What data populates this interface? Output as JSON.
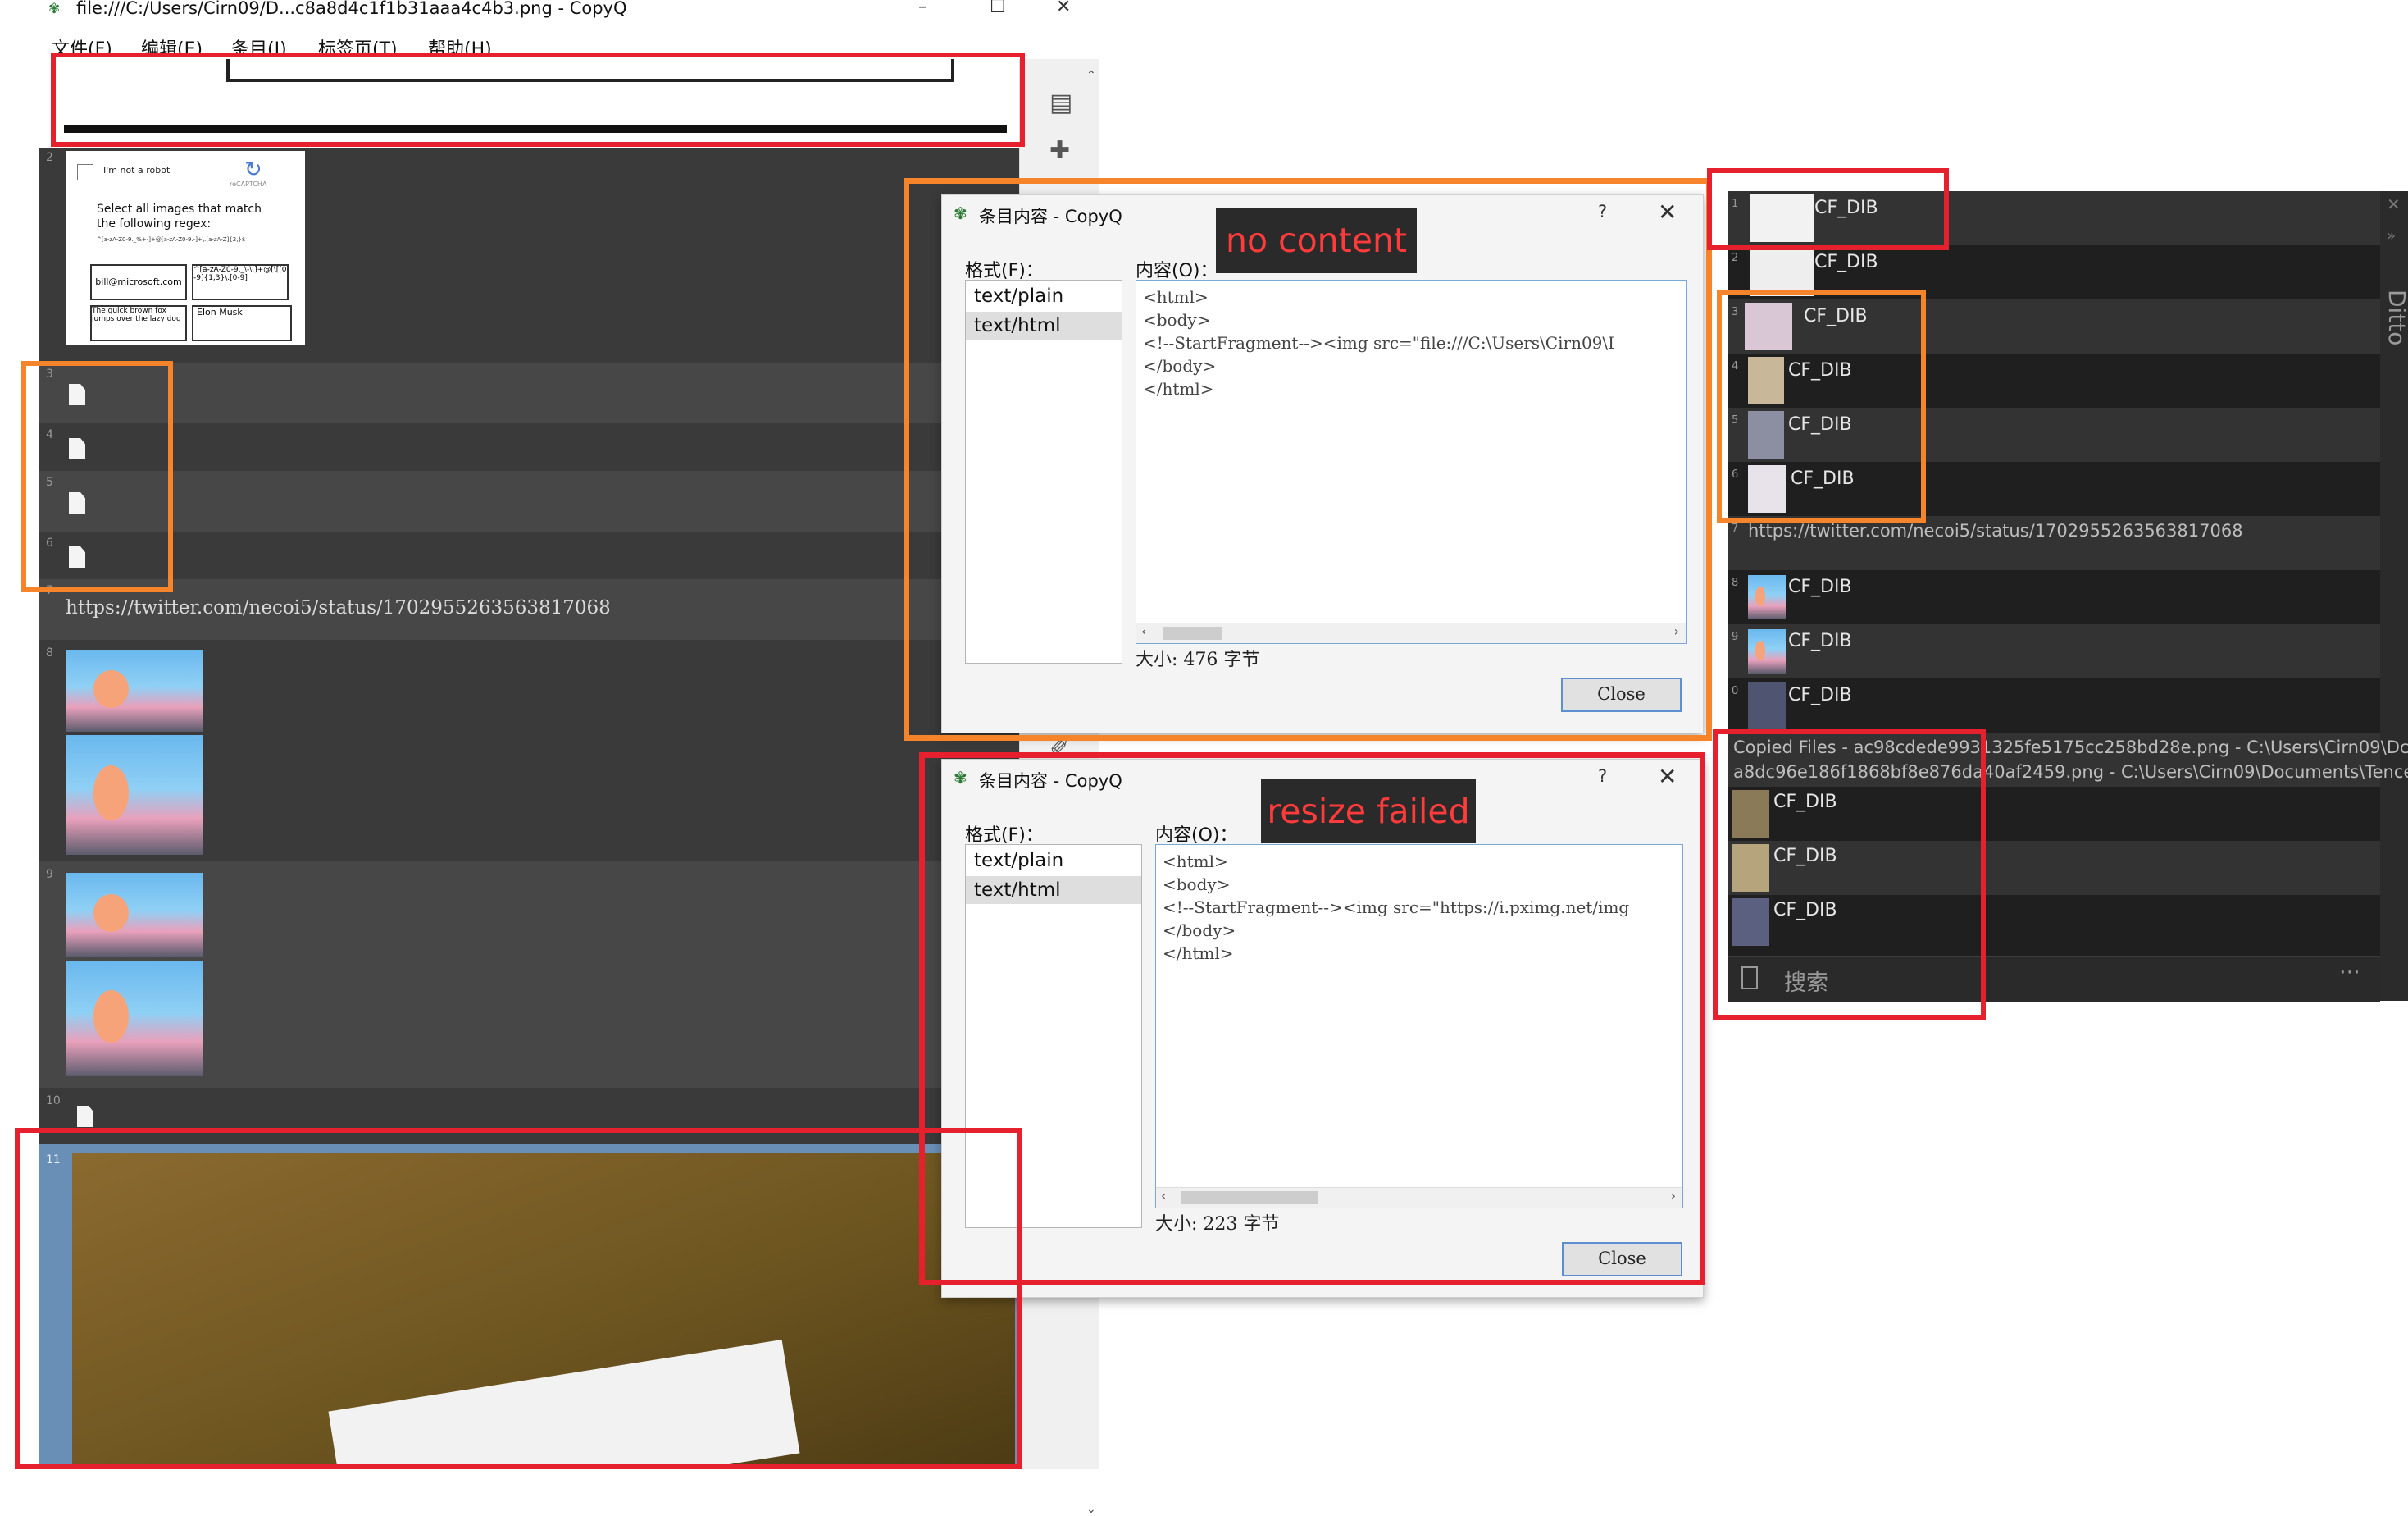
{
  "main": {
    "title": "file:///C:/Users/Cirn09/D...c8a8d4c1f1b31aaa4c4b3.png - CopyQ",
    "menu": [
      "文件(F)",
      "编辑(E)",
      "条目(I)",
      "标签页(T)",
      "帮助(H)"
    ],
    "rows": [
      {
        "num": "2"
      },
      {
        "num": "3"
      },
      {
        "num": "4"
      },
      {
        "num": "5"
      },
      {
        "num": "6"
      },
      {
        "num": "7",
        "text": "https://twitter.com/necoi5/status/1702955263563817068"
      },
      {
        "num": "8"
      },
      {
        "num": "9"
      },
      {
        "num": "10"
      },
      {
        "num": "11"
      }
    ],
    "captcha": {
      "checkbox_label": "I'm not a robot",
      "brand": "reCAPTCHA",
      "instruction": "Select all images that match the following regex:",
      "regex": "^[a-zA-Z0-9._%+-]+@[a-zA-Z0-9.-]+\\.[a-zA-Z]{2,}$",
      "cells": [
        "bill@microsoft.com",
        "^[a-zA-Z0-9._\\-\\.]+@[\\[[0-9]{1,3}\\.[0-9]",
        "The quick brown fox jumps over the lazy dog",
        "Elon Musk"
      ]
    }
  },
  "dialog1": {
    "title": "条目内容 - CopyQ",
    "format_label": "格式(F)：",
    "formats": [
      "text/plain",
      "text/html"
    ],
    "content_label": "内容(O)：",
    "content_lines": [
      "<html>",
      "<body>",
      "<!--StartFragment--><img src=\"file:///C:\\Users\\Cirn09\\I",
      "</body>",
      "</html>"
    ],
    "size": "大小: 476 字节",
    "close": "Close",
    "help": "?"
  },
  "dialog2": {
    "title": "条目内容 - CopyQ",
    "format_label": "格式(F)：",
    "formats": [
      "text/plain",
      "text/html"
    ],
    "content_label": "内容(O)：",
    "content_lines": [
      "<html>",
      "<body>",
      "<!--StartFragment--><img src=\"https://i.pximg.net/img",
      "</body>",
      "</html>"
    ],
    "size": "大小: 223 字节",
    "close": "Close",
    "help": "?"
  },
  "annotations": {
    "no_content": "no content",
    "resize_failed": "resize failed"
  },
  "ditto": {
    "side_label": "Ditto",
    "rows": [
      {
        "num": "1",
        "label": "CF_DIB"
      },
      {
        "num": "2",
        "label": "CF_DIB"
      },
      {
        "num": "3",
        "label": "CF_DIB"
      },
      {
        "num": "4",
        "label": "CF_DIB"
      },
      {
        "num": "5",
        "label": "CF_DIB"
      },
      {
        "num": "6",
        "label": "CF_DIB"
      },
      {
        "num": "7",
        "label": "https://twitter.com/necoi5/status/1702955263563817068"
      },
      {
        "num": "8",
        "label": "CF_DIB"
      },
      {
        "num": "9",
        "label": "CF_DIB"
      },
      {
        "num": "0",
        "label": "CF_DIB"
      }
    ],
    "copied_files_1": "Copied Files - ac98cdede9931325fe5175cc258bd28e.png - C:\\Users\\Cirn09\\Dc",
    "copied_files_2": "a8dc96e186f1868bf8e876da40af2459.png - C:\\Users\\Cirn09\\Documents\\Tence",
    "extra": [
      "CF_DIB",
      "CF_DIB",
      "CF_DIB"
    ],
    "search": "搜索",
    "more": "···"
  }
}
